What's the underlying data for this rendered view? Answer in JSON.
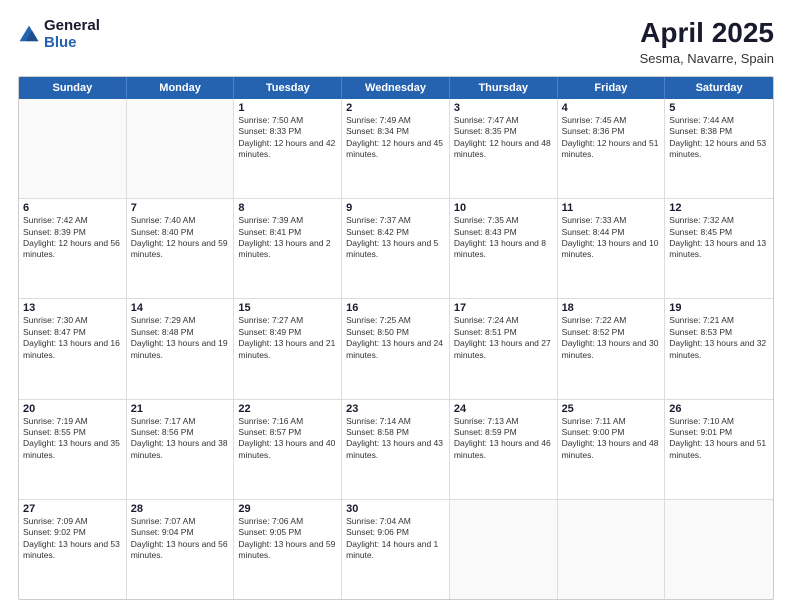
{
  "header": {
    "logo_general": "General",
    "logo_blue": "Blue",
    "month_title": "April 2025",
    "subtitle": "Sesma, Navarre, Spain"
  },
  "weekdays": [
    "Sunday",
    "Monday",
    "Tuesday",
    "Wednesday",
    "Thursday",
    "Friday",
    "Saturday"
  ],
  "rows": [
    [
      {
        "day": "",
        "text": ""
      },
      {
        "day": "",
        "text": ""
      },
      {
        "day": "1",
        "text": "Sunrise: 7:50 AM\nSunset: 8:33 PM\nDaylight: 12 hours and 42 minutes."
      },
      {
        "day": "2",
        "text": "Sunrise: 7:49 AM\nSunset: 8:34 PM\nDaylight: 12 hours and 45 minutes."
      },
      {
        "day": "3",
        "text": "Sunrise: 7:47 AM\nSunset: 8:35 PM\nDaylight: 12 hours and 48 minutes."
      },
      {
        "day": "4",
        "text": "Sunrise: 7:45 AM\nSunset: 8:36 PM\nDaylight: 12 hours and 51 minutes."
      },
      {
        "day": "5",
        "text": "Sunrise: 7:44 AM\nSunset: 8:38 PM\nDaylight: 12 hours and 53 minutes."
      }
    ],
    [
      {
        "day": "6",
        "text": "Sunrise: 7:42 AM\nSunset: 8:39 PM\nDaylight: 12 hours and 56 minutes."
      },
      {
        "day": "7",
        "text": "Sunrise: 7:40 AM\nSunset: 8:40 PM\nDaylight: 12 hours and 59 minutes."
      },
      {
        "day": "8",
        "text": "Sunrise: 7:39 AM\nSunset: 8:41 PM\nDaylight: 13 hours and 2 minutes."
      },
      {
        "day": "9",
        "text": "Sunrise: 7:37 AM\nSunset: 8:42 PM\nDaylight: 13 hours and 5 minutes."
      },
      {
        "day": "10",
        "text": "Sunrise: 7:35 AM\nSunset: 8:43 PM\nDaylight: 13 hours and 8 minutes."
      },
      {
        "day": "11",
        "text": "Sunrise: 7:33 AM\nSunset: 8:44 PM\nDaylight: 13 hours and 10 minutes."
      },
      {
        "day": "12",
        "text": "Sunrise: 7:32 AM\nSunset: 8:45 PM\nDaylight: 13 hours and 13 minutes."
      }
    ],
    [
      {
        "day": "13",
        "text": "Sunrise: 7:30 AM\nSunset: 8:47 PM\nDaylight: 13 hours and 16 minutes."
      },
      {
        "day": "14",
        "text": "Sunrise: 7:29 AM\nSunset: 8:48 PM\nDaylight: 13 hours and 19 minutes."
      },
      {
        "day": "15",
        "text": "Sunrise: 7:27 AM\nSunset: 8:49 PM\nDaylight: 13 hours and 21 minutes."
      },
      {
        "day": "16",
        "text": "Sunrise: 7:25 AM\nSunset: 8:50 PM\nDaylight: 13 hours and 24 minutes."
      },
      {
        "day": "17",
        "text": "Sunrise: 7:24 AM\nSunset: 8:51 PM\nDaylight: 13 hours and 27 minutes."
      },
      {
        "day": "18",
        "text": "Sunrise: 7:22 AM\nSunset: 8:52 PM\nDaylight: 13 hours and 30 minutes."
      },
      {
        "day": "19",
        "text": "Sunrise: 7:21 AM\nSunset: 8:53 PM\nDaylight: 13 hours and 32 minutes."
      }
    ],
    [
      {
        "day": "20",
        "text": "Sunrise: 7:19 AM\nSunset: 8:55 PM\nDaylight: 13 hours and 35 minutes."
      },
      {
        "day": "21",
        "text": "Sunrise: 7:17 AM\nSunset: 8:56 PM\nDaylight: 13 hours and 38 minutes."
      },
      {
        "day": "22",
        "text": "Sunrise: 7:16 AM\nSunset: 8:57 PM\nDaylight: 13 hours and 40 minutes."
      },
      {
        "day": "23",
        "text": "Sunrise: 7:14 AM\nSunset: 8:58 PM\nDaylight: 13 hours and 43 minutes."
      },
      {
        "day": "24",
        "text": "Sunrise: 7:13 AM\nSunset: 8:59 PM\nDaylight: 13 hours and 46 minutes."
      },
      {
        "day": "25",
        "text": "Sunrise: 7:11 AM\nSunset: 9:00 PM\nDaylight: 13 hours and 48 minutes."
      },
      {
        "day": "26",
        "text": "Sunrise: 7:10 AM\nSunset: 9:01 PM\nDaylight: 13 hours and 51 minutes."
      }
    ],
    [
      {
        "day": "27",
        "text": "Sunrise: 7:09 AM\nSunset: 9:02 PM\nDaylight: 13 hours and 53 minutes."
      },
      {
        "day": "28",
        "text": "Sunrise: 7:07 AM\nSunset: 9:04 PM\nDaylight: 13 hours and 56 minutes."
      },
      {
        "day": "29",
        "text": "Sunrise: 7:06 AM\nSunset: 9:05 PM\nDaylight: 13 hours and 59 minutes."
      },
      {
        "day": "30",
        "text": "Sunrise: 7:04 AM\nSunset: 9:06 PM\nDaylight: 14 hours and 1 minute."
      },
      {
        "day": "",
        "text": ""
      },
      {
        "day": "",
        "text": ""
      },
      {
        "day": "",
        "text": ""
      }
    ]
  ]
}
